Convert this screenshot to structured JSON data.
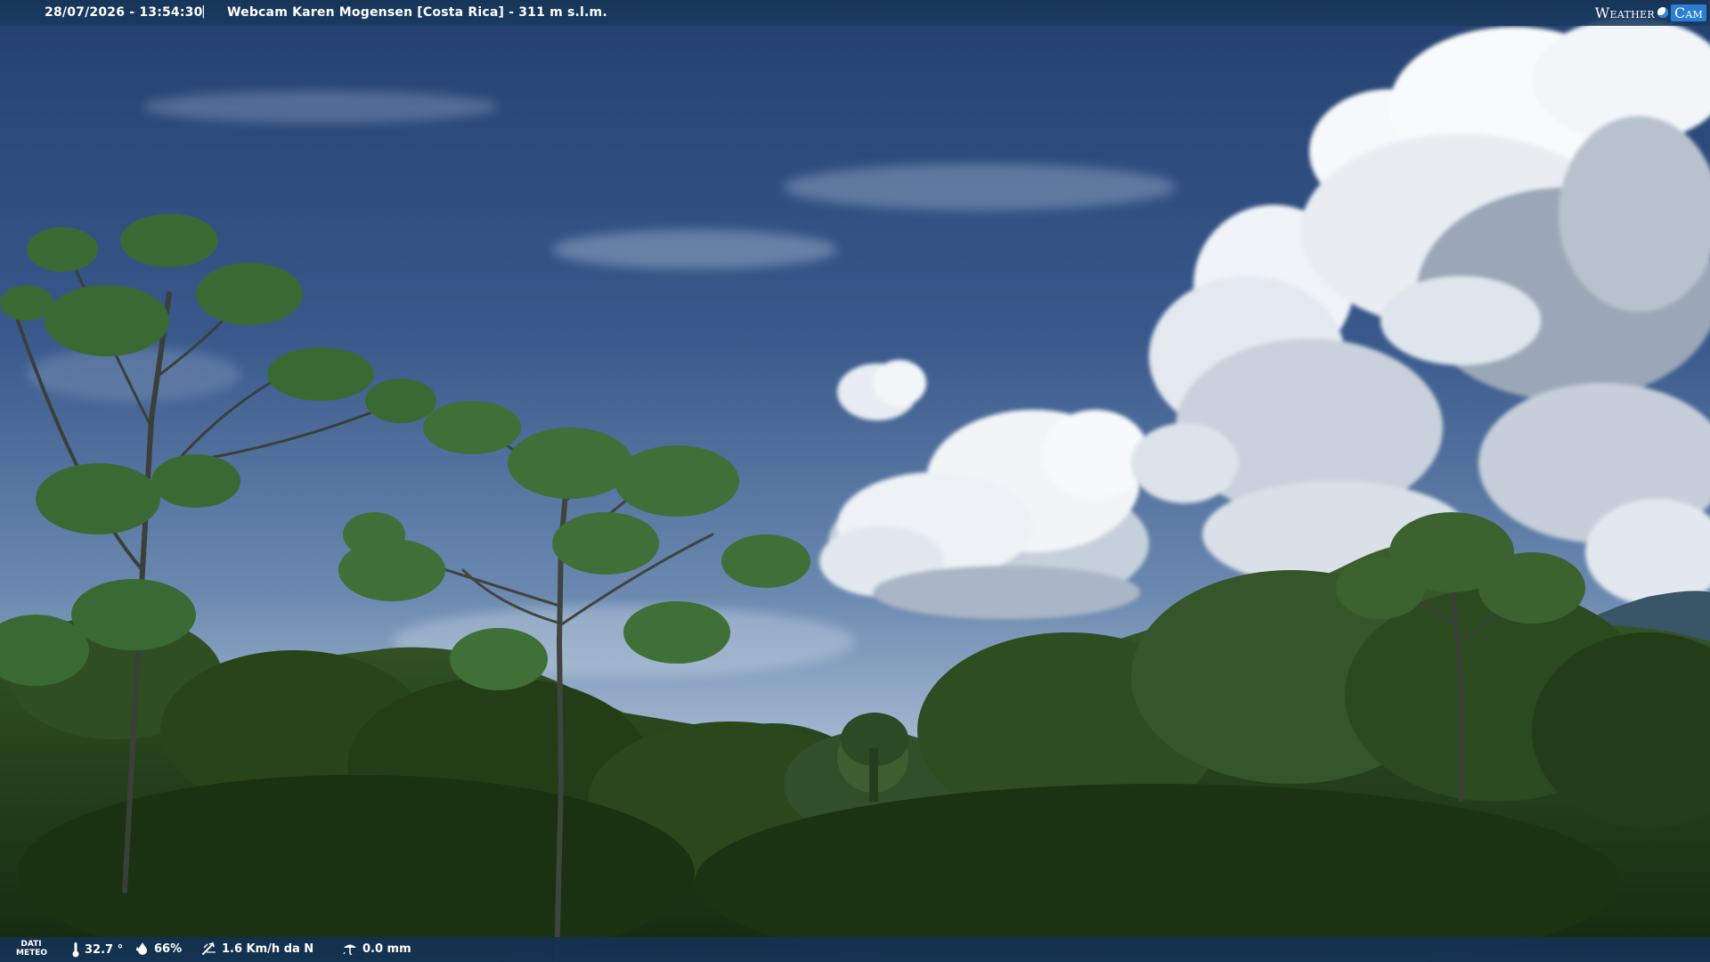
{
  "overlay": {
    "datetime": "28/07/2026 - 13:54:30",
    "separator": "|",
    "caption": "Webcam Karen Mogensen [Costa Rica] - 311 m s.l.m.",
    "logo_weather": "Weather",
    "logo_cam": "Cam"
  },
  "meteo": {
    "label_line1": "DATI",
    "label_line2": "METEO",
    "temperature": "32.7 °",
    "humidity": "66%",
    "wind": "1.6 Km/h da N",
    "rain": "0.0 mm"
  },
  "icons": {
    "temperature": "thermometer-icon",
    "humidity": "droplet-icon",
    "wind": "wind-icon",
    "rain": "rain-icon"
  },
  "colors": {
    "bar": "#183a62",
    "sky_top": "#2a4a7c",
    "sky_bottom": "#a9bfd6",
    "foliage": "#2c4a22"
  }
}
